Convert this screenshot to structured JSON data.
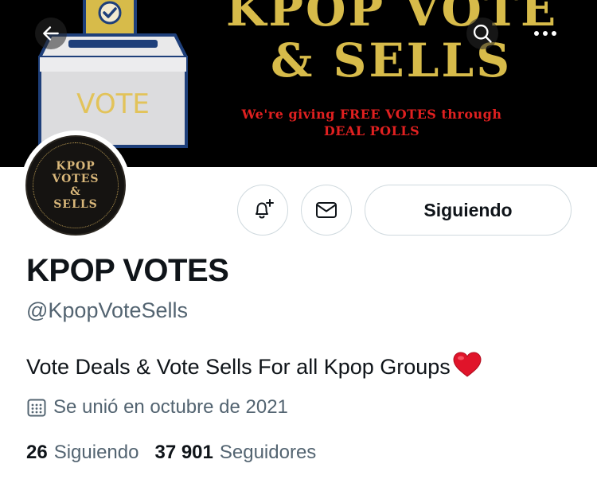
{
  "banner": {
    "title_line1": "KPOP VOTE",
    "title_line2": "& SELLS",
    "ballot_text": "VOTE",
    "subtitle_line1": "We're giving FREE VOTES through",
    "subtitle_line2": "DEAL POLLS"
  },
  "nav": {
    "back_icon": "arrow-left-icon",
    "search_icon": "search-icon",
    "more_icon": "more-horizontal-icon"
  },
  "avatar": {
    "line1": "KPOP",
    "line2": "VOTES",
    "line3": "&",
    "line4": "SELLS"
  },
  "actions": {
    "notify_icon": "bell-plus-icon",
    "message_icon": "envelope-icon",
    "follow_label": "Siguiendo"
  },
  "profile": {
    "name": "KPOP VOTES",
    "handle": "@KpopVoteSells",
    "bio": "Vote Deals & Vote Sells For all Kpop Groups",
    "bio_emoji": "red-heart-icon",
    "joined": "Se unió en octubre de 2021",
    "joined_icon": "calendar-icon"
  },
  "stats": {
    "following_count": "26",
    "following_label": "Siguiendo",
    "followers_count": "37 901",
    "followers_label": "Seguidores"
  },
  "colors": {
    "banner_bg": "#000000",
    "banner_gold": "#d7bb4a",
    "banner_red": "#e02020",
    "secondary_text": "#536471",
    "border": "#cfd9de",
    "heart": "#e0142a"
  }
}
